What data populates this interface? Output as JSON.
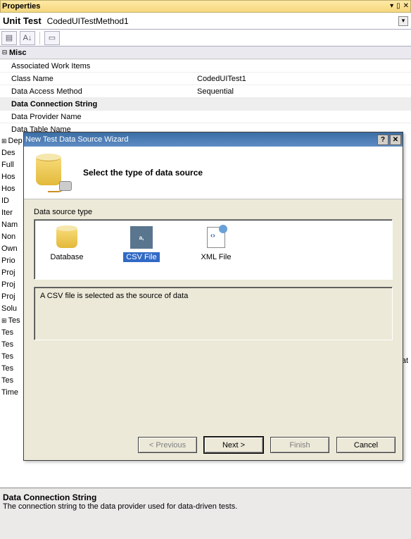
{
  "panel": {
    "title": "Properties"
  },
  "unit_test": {
    "label": "Unit Test",
    "name": "CodedUITestMethod1"
  },
  "category": {
    "name": "Misc"
  },
  "rows": [
    {
      "key": "Associated Work Items",
      "value": ""
    },
    {
      "key": "Class Name",
      "value": "CodedUITest1"
    },
    {
      "key": "Data Access Method",
      "value": "Sequential"
    },
    {
      "key": "Data Connection String",
      "value": "",
      "selected": true
    },
    {
      "key": "Data Provider Name",
      "value": ""
    },
    {
      "key": "Data Table Name",
      "value": ""
    }
  ],
  "left_keys": [
    {
      "t": "Dep",
      "plus": true
    },
    {
      "t": "Des"
    },
    {
      "t": "Full "
    },
    {
      "t": "Hos"
    },
    {
      "t": "Hos"
    },
    {
      "t": "ID"
    },
    {
      "t": "Iter"
    },
    {
      "t": "Nam"
    },
    {
      "t": "Non"
    },
    {
      "t": "Own"
    },
    {
      "t": "Prio"
    },
    {
      "t": "Proj"
    },
    {
      "t": "Proj"
    },
    {
      "t": "Proj"
    },
    {
      "t": "Solu"
    },
    {
      "t": "Tes",
      "plus": true
    },
    {
      "t": "Tes"
    },
    {
      "t": "Tes"
    },
    {
      "t": "Tes"
    },
    {
      "t": "Tes"
    },
    {
      "t": "Tes"
    },
    {
      "t": "Time"
    }
  ],
  "right_trunc": "fcat",
  "dialog": {
    "title": "New Test Data Source Wizard",
    "heading": "Select the type of data source",
    "list_label": "Data source type",
    "options": [
      {
        "id": "database",
        "label": "Database"
      },
      {
        "id": "csv",
        "label": "CSV File",
        "selected": true
      },
      {
        "id": "xml",
        "label": "XML File"
      }
    ],
    "description": "A CSV file is selected as the source of data",
    "buttons": {
      "prev": "< Previous",
      "next": "Next >",
      "finish": "Finish",
      "cancel": "Cancel"
    }
  },
  "bottom": {
    "heading": "Data Connection String",
    "desc": "The connection string to the data provider used for data-driven tests."
  }
}
